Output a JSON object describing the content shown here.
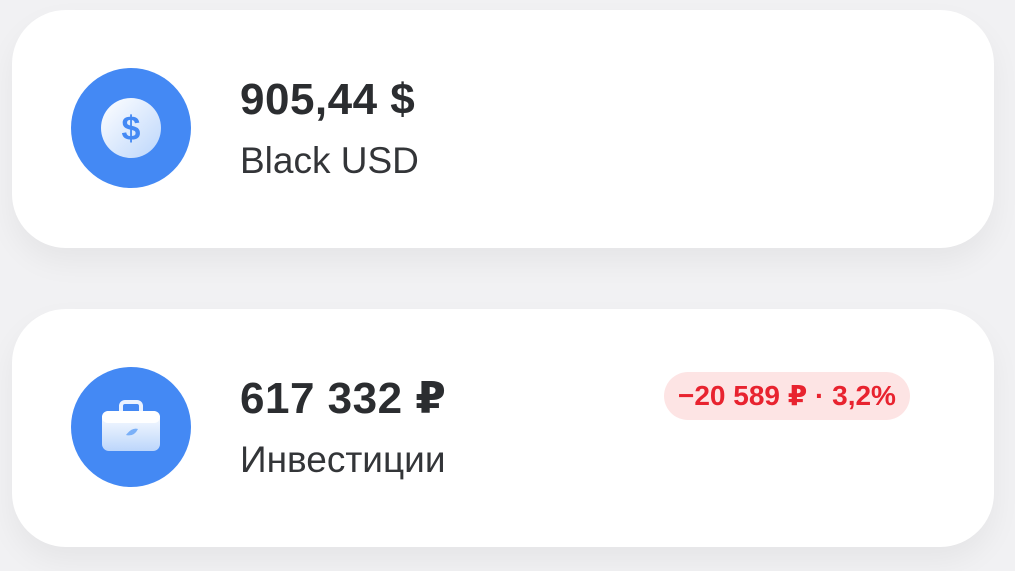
{
  "accounts": [
    {
      "amount": "905,44 $",
      "label": "Black USD",
      "icon": "dollar-coin-icon"
    },
    {
      "amount": "617 332 ₽",
      "label": "Инвестиции",
      "icon": "briefcase-icon",
      "change": "−20 589 ₽ · 3,2%"
    }
  ],
  "colors": {
    "icon_bg": "#4489f4",
    "change_text": "#e8232f",
    "change_bg": "#fde4e4"
  }
}
